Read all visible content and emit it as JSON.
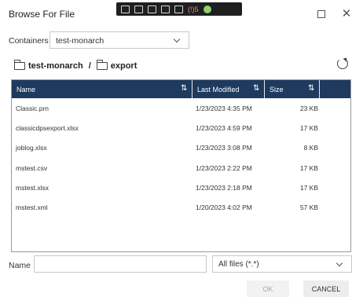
{
  "window": {
    "title": "Browse For File"
  },
  "tray": {
    "badge_text": "(!)5"
  },
  "containers": {
    "label": "Containers",
    "selected": "test-monarch"
  },
  "breadcrumb": {
    "items": [
      "test-monarch",
      "export"
    ],
    "separator": "/"
  },
  "grid": {
    "columns": [
      "Name",
      "Last Modified",
      "Size"
    ],
    "rows": [
      {
        "name": "Classic.prn",
        "modified": "1/23/2023 4:35 PM",
        "size": "23 KB"
      },
      {
        "name": "classicdpsexport.xlsx",
        "modified": "1/23/2023 4:59 PM",
        "size": "17 KB"
      },
      {
        "name": "joblog.xlsx",
        "modified": "1/23/2023 3:08 PM",
        "size": "8 KB"
      },
      {
        "name": "mstest.csv",
        "modified": "1/23/2023 2:22 PM",
        "size": "17 KB"
      },
      {
        "name": "mstest.xlsx",
        "modified": "1/23/2023 2:18 PM",
        "size": "17 KB"
      },
      {
        "name": "mstest.xml",
        "modified": "1/20/2023 4:02 PM",
        "size": "57 KB"
      }
    ]
  },
  "footer": {
    "name_label": "Name",
    "name_value": "",
    "filter_selected": "All files (*.*)",
    "ok_label": "OK",
    "cancel_label": "CANCEL"
  },
  "colors": {
    "header_bg": "#1e3a5f",
    "header_text": "#ffffff"
  },
  "icons": [
    "folder-icon",
    "refresh-icon",
    "sort-icon",
    "chevron-down-icon",
    "maximize-icon",
    "close-icon"
  ]
}
